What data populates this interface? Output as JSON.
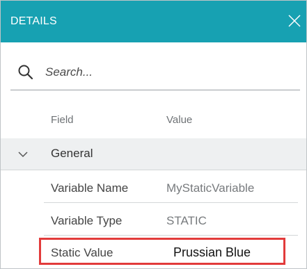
{
  "panel": {
    "title": "DETAILS",
    "close_icon": "close-icon",
    "accent_color": "#17a1b2"
  },
  "search": {
    "placeholder": "Search...",
    "value": "",
    "icon": "search-icon"
  },
  "table": {
    "columns": [
      "Field",
      "Value"
    ],
    "group": {
      "label": "General",
      "icon": "chevron-down-icon",
      "expanded": true
    },
    "rows": [
      {
        "field": "Variable Name",
        "value": "MyStaticVariable"
      },
      {
        "field": "Variable Type",
        "value": "STATIC"
      },
      {
        "field": "Static Value",
        "value": "Prussian Blue"
      }
    ]
  },
  "highlight_color": "#e23b3b"
}
